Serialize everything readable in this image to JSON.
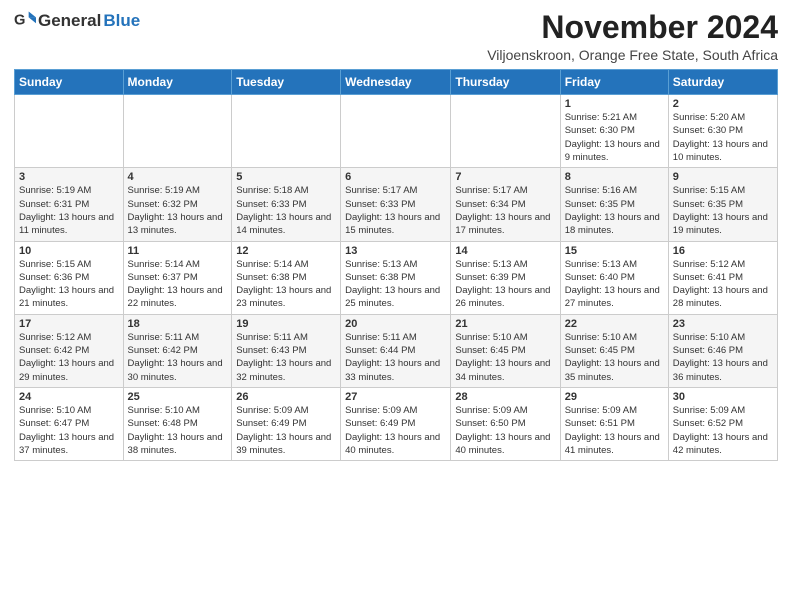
{
  "header": {
    "logo_general": "General",
    "logo_blue": "Blue",
    "month_title": "November 2024",
    "subtitle": "Viljoenskroon, Orange Free State, South Africa"
  },
  "days_of_week": [
    "Sunday",
    "Monday",
    "Tuesday",
    "Wednesday",
    "Thursday",
    "Friday",
    "Saturday"
  ],
  "weeks": [
    [
      {
        "day": "",
        "info": ""
      },
      {
        "day": "",
        "info": ""
      },
      {
        "day": "",
        "info": ""
      },
      {
        "day": "",
        "info": ""
      },
      {
        "day": "",
        "info": ""
      },
      {
        "day": "1",
        "info": "Sunrise: 5:21 AM\nSunset: 6:30 PM\nDaylight: 13 hours and 9 minutes."
      },
      {
        "day": "2",
        "info": "Sunrise: 5:20 AM\nSunset: 6:30 PM\nDaylight: 13 hours and 10 minutes."
      }
    ],
    [
      {
        "day": "3",
        "info": "Sunrise: 5:19 AM\nSunset: 6:31 PM\nDaylight: 13 hours and 11 minutes."
      },
      {
        "day": "4",
        "info": "Sunrise: 5:19 AM\nSunset: 6:32 PM\nDaylight: 13 hours and 13 minutes."
      },
      {
        "day": "5",
        "info": "Sunrise: 5:18 AM\nSunset: 6:33 PM\nDaylight: 13 hours and 14 minutes."
      },
      {
        "day": "6",
        "info": "Sunrise: 5:17 AM\nSunset: 6:33 PM\nDaylight: 13 hours and 15 minutes."
      },
      {
        "day": "7",
        "info": "Sunrise: 5:17 AM\nSunset: 6:34 PM\nDaylight: 13 hours and 17 minutes."
      },
      {
        "day": "8",
        "info": "Sunrise: 5:16 AM\nSunset: 6:35 PM\nDaylight: 13 hours and 18 minutes."
      },
      {
        "day": "9",
        "info": "Sunrise: 5:15 AM\nSunset: 6:35 PM\nDaylight: 13 hours and 19 minutes."
      }
    ],
    [
      {
        "day": "10",
        "info": "Sunrise: 5:15 AM\nSunset: 6:36 PM\nDaylight: 13 hours and 21 minutes."
      },
      {
        "day": "11",
        "info": "Sunrise: 5:14 AM\nSunset: 6:37 PM\nDaylight: 13 hours and 22 minutes."
      },
      {
        "day": "12",
        "info": "Sunrise: 5:14 AM\nSunset: 6:38 PM\nDaylight: 13 hours and 23 minutes."
      },
      {
        "day": "13",
        "info": "Sunrise: 5:13 AM\nSunset: 6:38 PM\nDaylight: 13 hours and 25 minutes."
      },
      {
        "day": "14",
        "info": "Sunrise: 5:13 AM\nSunset: 6:39 PM\nDaylight: 13 hours and 26 minutes."
      },
      {
        "day": "15",
        "info": "Sunrise: 5:13 AM\nSunset: 6:40 PM\nDaylight: 13 hours and 27 minutes."
      },
      {
        "day": "16",
        "info": "Sunrise: 5:12 AM\nSunset: 6:41 PM\nDaylight: 13 hours and 28 minutes."
      }
    ],
    [
      {
        "day": "17",
        "info": "Sunrise: 5:12 AM\nSunset: 6:42 PM\nDaylight: 13 hours and 29 minutes."
      },
      {
        "day": "18",
        "info": "Sunrise: 5:11 AM\nSunset: 6:42 PM\nDaylight: 13 hours and 30 minutes."
      },
      {
        "day": "19",
        "info": "Sunrise: 5:11 AM\nSunset: 6:43 PM\nDaylight: 13 hours and 32 minutes."
      },
      {
        "day": "20",
        "info": "Sunrise: 5:11 AM\nSunset: 6:44 PM\nDaylight: 13 hours and 33 minutes."
      },
      {
        "day": "21",
        "info": "Sunrise: 5:10 AM\nSunset: 6:45 PM\nDaylight: 13 hours and 34 minutes."
      },
      {
        "day": "22",
        "info": "Sunrise: 5:10 AM\nSunset: 6:45 PM\nDaylight: 13 hours and 35 minutes."
      },
      {
        "day": "23",
        "info": "Sunrise: 5:10 AM\nSunset: 6:46 PM\nDaylight: 13 hours and 36 minutes."
      }
    ],
    [
      {
        "day": "24",
        "info": "Sunrise: 5:10 AM\nSunset: 6:47 PM\nDaylight: 13 hours and 37 minutes."
      },
      {
        "day": "25",
        "info": "Sunrise: 5:10 AM\nSunset: 6:48 PM\nDaylight: 13 hours and 38 minutes."
      },
      {
        "day": "26",
        "info": "Sunrise: 5:09 AM\nSunset: 6:49 PM\nDaylight: 13 hours and 39 minutes."
      },
      {
        "day": "27",
        "info": "Sunrise: 5:09 AM\nSunset: 6:49 PM\nDaylight: 13 hours and 40 minutes."
      },
      {
        "day": "28",
        "info": "Sunrise: 5:09 AM\nSunset: 6:50 PM\nDaylight: 13 hours and 40 minutes."
      },
      {
        "day": "29",
        "info": "Sunrise: 5:09 AM\nSunset: 6:51 PM\nDaylight: 13 hours and 41 minutes."
      },
      {
        "day": "30",
        "info": "Sunrise: 5:09 AM\nSunset: 6:52 PM\nDaylight: 13 hours and 42 minutes."
      }
    ]
  ]
}
